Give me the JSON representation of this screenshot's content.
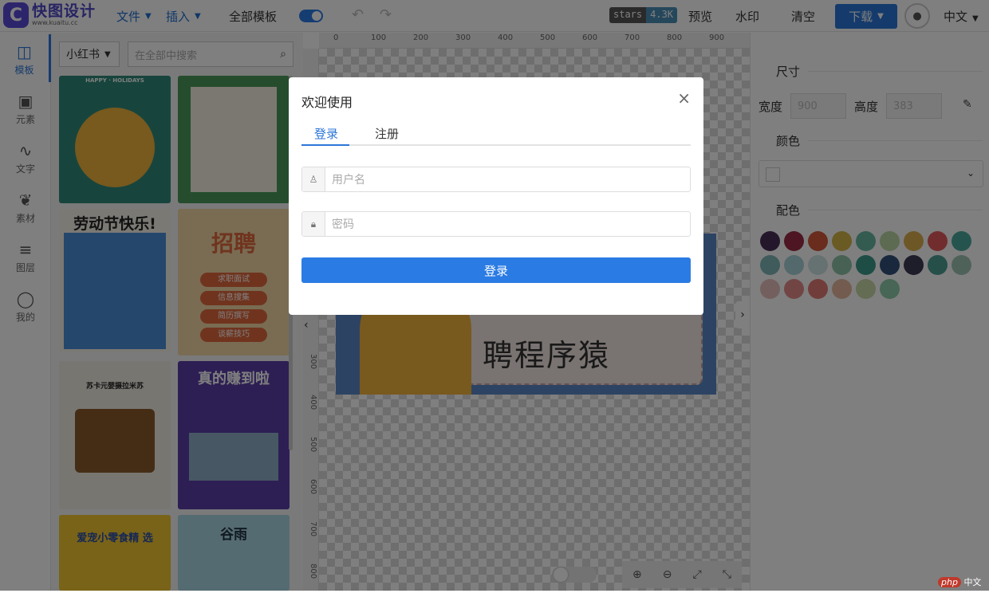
{
  "app": {
    "title": "快图设计",
    "subtitle": "www.kuaitu.cc"
  },
  "topbar": {
    "file": "文件",
    "insert": "插入",
    "all_templates": "全部模板",
    "stars_key": "stars",
    "stars_val": "4.3K",
    "preview": "预览",
    "watermark": "水印",
    "clear": "清空",
    "download": "下载",
    "language": "中文"
  },
  "sidebar": {
    "items": [
      {
        "label": "模板",
        "icon": "book-icon"
      },
      {
        "label": "元素",
        "icon": "image-icon"
      },
      {
        "label": "文字",
        "icon": "waveform-icon"
      },
      {
        "label": "素材",
        "icon": "leaf-icon"
      },
      {
        "label": "图层",
        "icon": "layers-icon"
      },
      {
        "label": "我的",
        "icon": "user-icon"
      }
    ]
  },
  "panel": {
    "category": "小红书",
    "search_placeholder": "在全部中搜索",
    "thumbs": [
      {
        "text": "HAPPY · HOLIDAYS",
        "color": "#2e8b7a"
      },
      {
        "text": "",
        "color": "#4a9a5a"
      },
      {
        "text": "劳动节快乐!",
        "color": "#f7f3e8"
      },
      {
        "text": "招聘",
        "color": "#f3d9a6"
      },
      {
        "text": "苏卡元婴摄拉米苏",
        "color": "#f1ece3"
      },
      {
        "text": "真的赚到啦",
        "color": "#5b3ea8"
      },
      {
        "text": "爱宠小零食精 选",
        "color": "#f2c630"
      },
      {
        "text": "谷雨",
        "color": "#a9d7e2"
      }
    ],
    "thumb_sub": [
      "求职面试",
      "信息搜集",
      "简历撰写",
      "谈薪技巧"
    ]
  },
  "ruler": {
    "top": [
      "0",
      "100",
      "200",
      "300",
      "400",
      "500",
      "600",
      "700",
      "800",
      "900"
    ],
    "left": [
      "300",
      "400",
      "500",
      "600",
      "700",
      "800"
    ]
  },
  "poster": {
    "line2": "聘程序猿"
  },
  "right": {
    "size": "尺寸",
    "width_label": "宽度",
    "width_val": "900",
    "height_label": "高度",
    "height_val": "383",
    "color": "颜色",
    "palette": "配色",
    "swatches": [
      "#4b2f57",
      "#9a2d44",
      "#d2593a",
      "#d4b548",
      "#69b7a0",
      "#b9d6a4",
      "#dcae4e",
      "#e25b5b",
      "#4aa89c",
      "#7fb6b6",
      "#a9d2d6",
      "#cde4e2",
      "#8fc4a8",
      "#3d9b8b",
      "#32517a",
      "#3d3a55",
      "#4d9e94",
      "#9ec4b4",
      "#e7c0bc",
      "#e58a8a",
      "#e27a74",
      "#e7b99e",
      "#c9d8a6",
      "#8fcdaa"
    ]
  },
  "modal": {
    "title": "欢迎使用",
    "tab_login": "登录",
    "tab_register": "注册",
    "username_placeholder": "用户名",
    "password_placeholder": "密码",
    "login_button": "登录"
  },
  "watermark": {
    "php": "php",
    "site": "中文网"
  }
}
